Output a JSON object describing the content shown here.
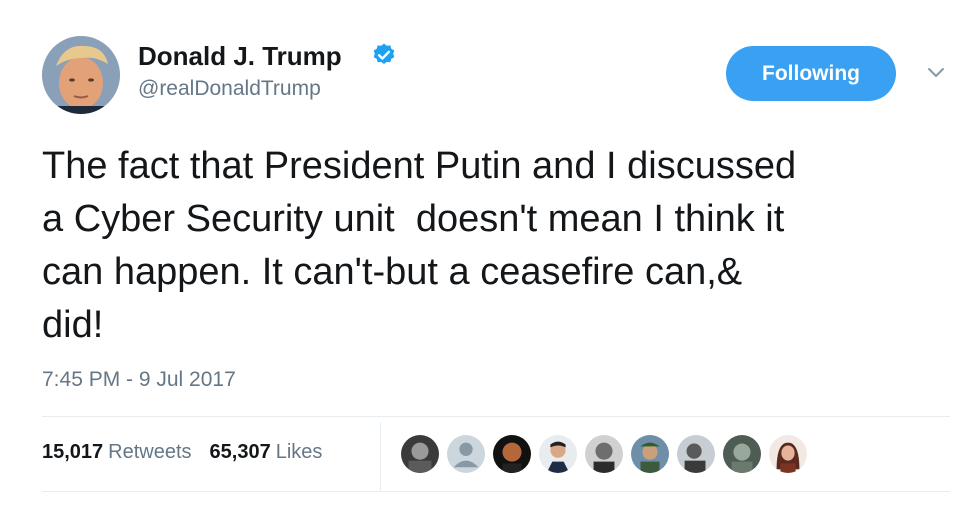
{
  "author": {
    "name": "Donald J. Trump",
    "handle": "@realDonaldTrump",
    "verified_icon": "verified-badge-icon",
    "avatar_icon": "profile-avatar"
  },
  "actions": {
    "follow_label": "Following",
    "menu_icon": "chevron-down-icon"
  },
  "tweet": {
    "text": "The fact that President Putin and I discussed\na Cyber Security unit  doesn't mean I think it\ncan happen. It can't-but a ceasefire can,&\ndid!",
    "timestamp": "7:45 PM - 9 Jul 2017"
  },
  "stats": {
    "retweets_count": "15,017",
    "retweets_label": "Retweets",
    "likes_count": "65,307",
    "likes_label": "Likes"
  },
  "likers": [
    "liker-avatar",
    "liker-avatar",
    "liker-avatar",
    "liker-avatar",
    "liker-avatar",
    "liker-avatar",
    "liker-avatar",
    "liker-avatar",
    "liker-avatar"
  ],
  "colors": {
    "accent": "#3aa1f2",
    "muted": "#657786",
    "text": "#14171a",
    "divider": "#e6ecf0"
  }
}
